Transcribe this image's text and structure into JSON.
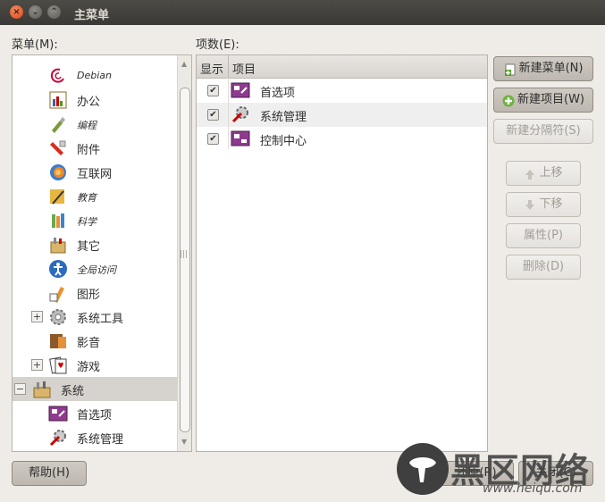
{
  "window": {
    "title": "主菜单"
  },
  "left": {
    "label": "菜单(M):",
    "items": [
      {
        "label": "Debian",
        "icon": "debian-icon",
        "italic": true,
        "expander": ""
      },
      {
        "label": "办公",
        "icon": "office-icon",
        "italic": false,
        "expander": ""
      },
      {
        "label": "编程",
        "icon": "programming-icon",
        "italic": true,
        "expander": ""
      },
      {
        "label": "附件",
        "icon": "accessories-icon",
        "italic": false,
        "expander": ""
      },
      {
        "label": "互联网",
        "icon": "internet-icon",
        "italic": false,
        "expander": ""
      },
      {
        "label": "教育",
        "icon": "education-icon",
        "italic": true,
        "expander": ""
      },
      {
        "label": "科学",
        "icon": "science-icon",
        "italic": true,
        "expander": ""
      },
      {
        "label": "其它",
        "icon": "other-icon",
        "italic": false,
        "expander": ""
      },
      {
        "label": "全局访问",
        "icon": "accessibility-icon",
        "italic": true,
        "expander": ""
      },
      {
        "label": "图形",
        "icon": "graphics-icon",
        "italic": false,
        "expander": ""
      },
      {
        "label": "系统工具",
        "icon": "system-tools-icon",
        "italic": false,
        "expander": "+"
      },
      {
        "label": "影音",
        "icon": "multimedia-icon",
        "italic": false,
        "expander": ""
      },
      {
        "label": "游戏",
        "icon": "games-icon",
        "italic": false,
        "expander": "+"
      },
      {
        "label": "系统",
        "icon": "system-icon",
        "italic": false,
        "expander": "−"
      },
      {
        "label": "首选项",
        "icon": "preferences-icon",
        "italic": false,
        "expander": ""
      },
      {
        "label": "系统管理",
        "icon": "administration-icon",
        "italic": false,
        "expander": ""
      }
    ]
  },
  "right": {
    "label": "项数(E):",
    "headers": {
      "show": "显示",
      "item": "项目"
    },
    "rows": [
      {
        "checked": "✔",
        "label": "首选项",
        "icon": "preferences-icon"
      },
      {
        "checked": "✔",
        "label": "系统管理",
        "icon": "administration-icon"
      },
      {
        "checked": "✔",
        "label": "控制中心",
        "icon": "control-center-icon"
      }
    ]
  },
  "buttons": {
    "new_menu": "新建菜单(N)",
    "new_item": "新建项目(W)",
    "new_separator": "新建分隔符(S)",
    "move_up": "上移",
    "move_down": "下移",
    "properties": "属性(P)",
    "delete": "删除(D)",
    "help": "帮助(H)",
    "revert": "还原(R)",
    "close": "关闭(C)"
  },
  "watermark": {
    "text": "黑区网络",
    "url": "www.heiqu.com"
  },
  "colors": {
    "titlebar": "#3c3b37",
    "close_button": "#e05a2b",
    "selection": "#d6d2cd"
  }
}
